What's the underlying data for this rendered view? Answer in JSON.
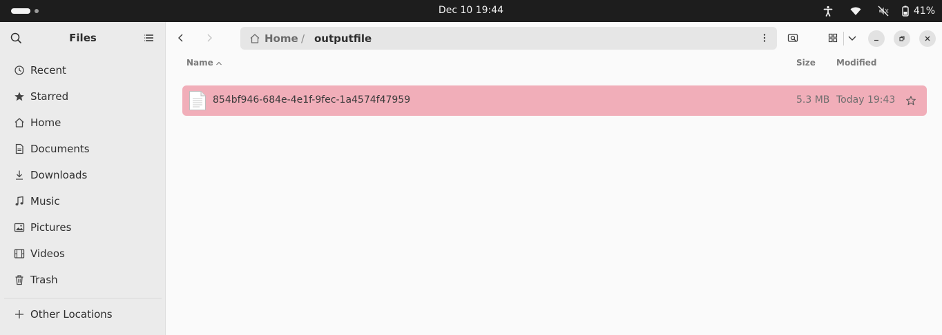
{
  "topbar": {
    "clock": "Dec 10  19:44",
    "battery": "41%",
    "icons": [
      "accessibility-icon",
      "wifi-icon",
      "volume-muted-icon",
      "battery-icon"
    ]
  },
  "sidebar": {
    "title": "Files",
    "items": [
      {
        "label": "Recent",
        "icon": "clock-icon"
      },
      {
        "label": "Starred",
        "icon": "star-icon"
      },
      {
        "label": "Home",
        "icon": "home-icon"
      },
      {
        "label": "Documents",
        "icon": "document-icon"
      },
      {
        "label": "Downloads",
        "icon": "download-icon"
      },
      {
        "label": "Music",
        "icon": "music-icon"
      },
      {
        "label": "Pictures",
        "icon": "picture-icon"
      },
      {
        "label": "Videos",
        "icon": "video-icon"
      },
      {
        "label": "Trash",
        "icon": "trash-icon"
      }
    ],
    "other": {
      "label": "Other Locations",
      "icon": "plus-icon"
    }
  },
  "pathbar": {
    "home": "Home",
    "separator": "/",
    "current": "outputfile"
  },
  "list": {
    "columns": {
      "name": "Name",
      "size": "Size",
      "modified": "Modified"
    },
    "rows": [
      {
        "name": "854bf946-684e-4e1f-9fec-1a4574f47959",
        "size": "5.3 MB",
        "modified": "Today 19:43"
      }
    ]
  },
  "colors": {
    "selection": "#f1aeb9",
    "topbar": "#1d1d1d",
    "sidebar": "#ebebeb",
    "pathbar": "#e6e6e6"
  }
}
